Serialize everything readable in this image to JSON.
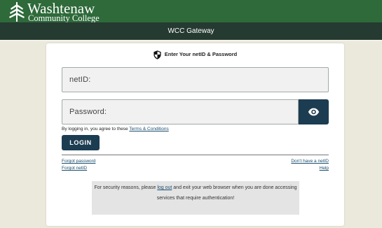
{
  "header": {
    "logo_line1": "Washtenaw",
    "logo_line2": "Community College",
    "title": "WCC Gateway"
  },
  "login": {
    "heading": "Enter Your netID & Password",
    "netid_placeholder": "netID:",
    "password_placeholder": "Password:",
    "agree_prefix": "By logging in, you agree to these ",
    "terms_link": "Terms & Conditions",
    "login_button": "LOGIN"
  },
  "links": {
    "forgot_password": "Forgot password",
    "forgot_netid": "Forgot netID",
    "no_netid": "Don't have a netID",
    "help": "Help"
  },
  "security": {
    "prefix": "For security reasons, please ",
    "logout_link": "log out",
    "suffix": " and exit your web browser when you are done accessing services that require authentication!"
  },
  "colors": {
    "header_green": "#2e6a3a",
    "titlebar": "#253a30",
    "button_navy": "#1c3c51",
    "page_bg": "#ebe9dc"
  },
  "icons": [
    "leaf-logo-icon",
    "shield-icon",
    "eye-icon"
  ]
}
